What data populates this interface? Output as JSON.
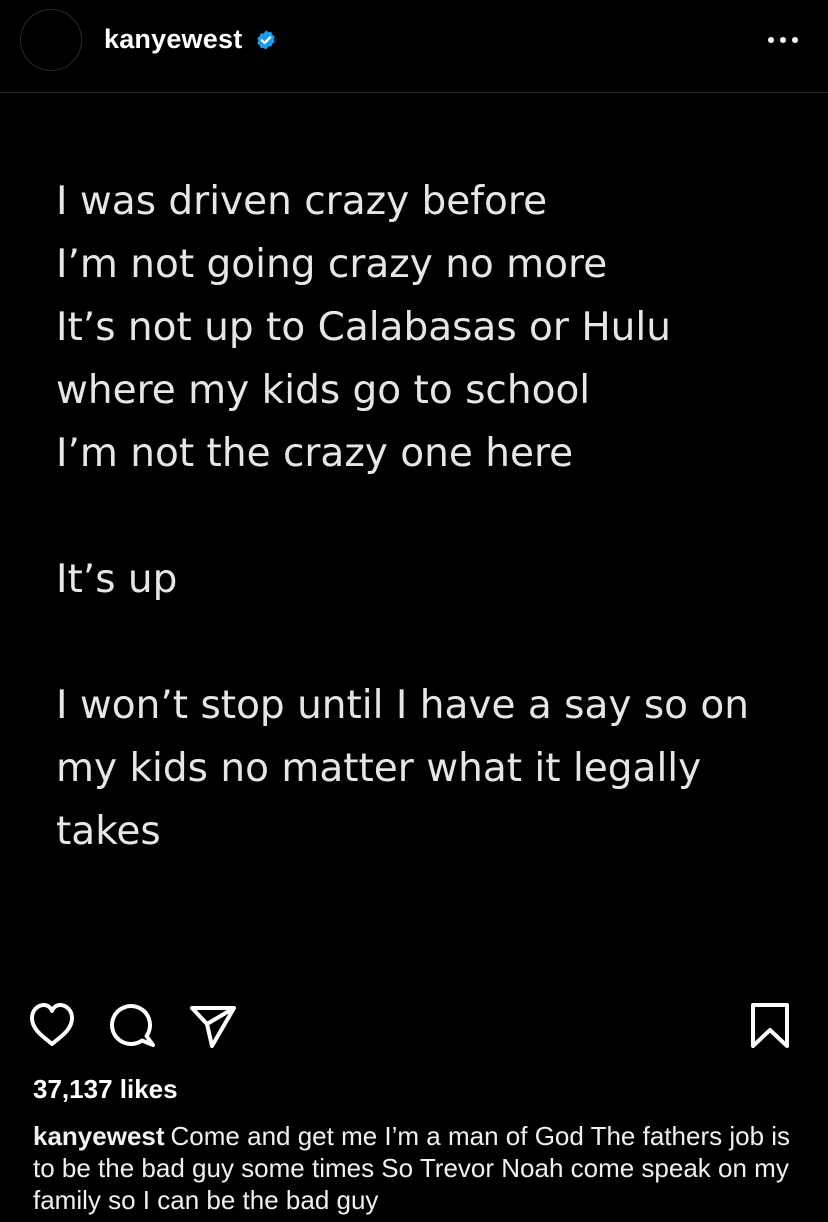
{
  "header": {
    "username": "kanyewest",
    "verified_icon": "verified-badge-icon",
    "verified_color": "#1d9bf0",
    "more_icon": "more-options-icon"
  },
  "post": {
    "text": "I was driven crazy before\nI’m not going crazy no more\nIt’s not up to Calabasas or Hulu\nwhere my kids go to school\nI’m not the crazy one here\n\nIt’s up\n\nI won’t stop until I have a say so on\nmy kids no matter what it legally\ntakes"
  },
  "actions": {
    "like_icon": "heart-icon",
    "comment_icon": "comment-icon",
    "share_icon": "share-icon",
    "save_icon": "bookmark-icon"
  },
  "likes": "37,137 likes",
  "caption": {
    "username": "kanyewest",
    "text": "Come and get me  I’m a man of God  The fathers job is to be the bad guy some times  So Trevor Noah come speak on my family so I can be the bad guy"
  }
}
